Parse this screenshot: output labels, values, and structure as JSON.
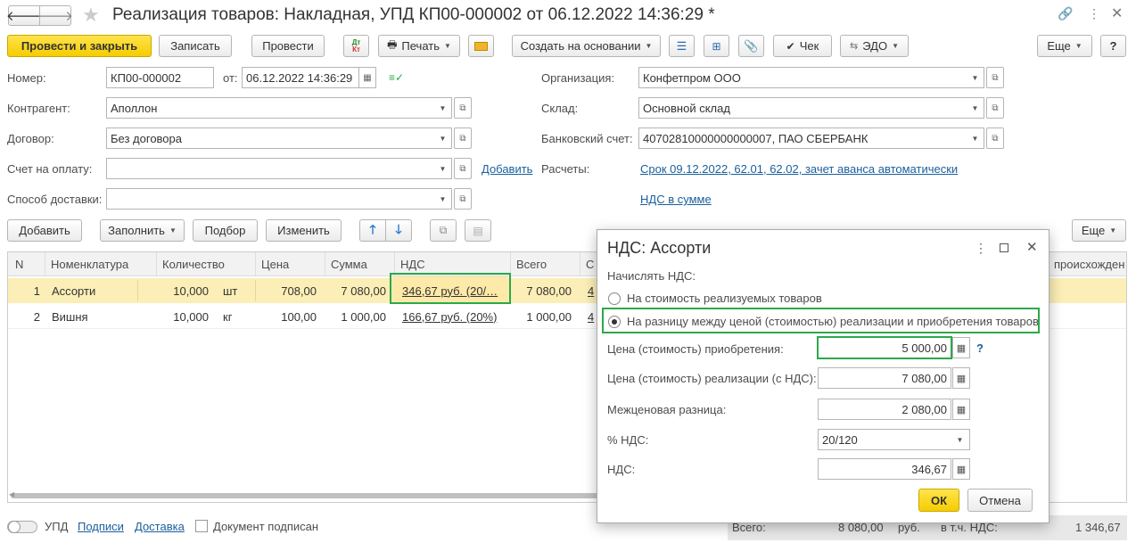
{
  "window": {
    "title": "Реализация товаров: Накладная, УПД КП00-000002 от 06.12.2022 14:36:29 *"
  },
  "toolbar": {
    "post_close": "Провести и закрыть",
    "save": "Записать",
    "post": "Провести",
    "print": "Печать",
    "create_based": "Создать на основании",
    "receipt": "Чек",
    "edo": "ЭДО",
    "more": "Еще",
    "help": "?",
    "dtkt_top": "Дт",
    "dtkt_bottom": "Кт"
  },
  "form": {
    "number_label": "Номер:",
    "number_value": "КП00-000002",
    "date_label": "от:",
    "date_value": "06.12.2022 14:36:29",
    "contractor_label": "Контрагент:",
    "contractor_value": "Аполлон",
    "contract_label": "Договор:",
    "contract_value": "Без договора",
    "invoice_label": "Счет на оплату:",
    "invoice_value": "",
    "invoice_add": "Добавить",
    "delivery_label": "Способ доставки:",
    "delivery_value": "",
    "org_label": "Организация:",
    "org_value": "Конфетпром ООО",
    "warehouse_label": "Склад:",
    "warehouse_value": "Основной склад",
    "bank_label": "Банковский счет:",
    "bank_value": "40702810000000000007, ПАО СБЕРБАНК",
    "settlements_label": "Расчеты:",
    "settlements_link": "Срок 09.12.2022, 62.01, 62.02, зачет аванса автоматически",
    "vat_link": "НДС в сумме"
  },
  "table_toolbar": {
    "add": "Добавить",
    "fill": "Заполнить",
    "pick": "Подбор",
    "change": "Изменить",
    "more": "Еще"
  },
  "table": {
    "headers": [
      "N",
      "Номенклатура",
      "Количество",
      "Цена",
      "Сумма",
      "НДС",
      "Всего",
      "С",
      "происхожден"
    ],
    "rows": [
      {
        "n": "1",
        "name": "Ассорти",
        "qty": "10,000",
        "unit": "шт",
        "price": "708,00",
        "sum": "7 080,00",
        "vat": "346,67 руб. (20/…",
        "total": "7 080,00",
        "extra": "4"
      },
      {
        "n": "2",
        "name": "Вишня",
        "qty": "10,000",
        "unit": "кг",
        "price": "100,00",
        "sum": "1 000,00",
        "vat": "166,67 руб. (20%)",
        "total": "1 000,00",
        "extra": "4"
      }
    ]
  },
  "footer": {
    "upd": "УПД",
    "signatures": "Подписи",
    "delivery": "Доставка",
    "signed": "Документ подписан",
    "total_label": "Всего:",
    "total_value": "8 080,00",
    "currency": "руб.",
    "vat_label": "в т.ч. НДС:",
    "vat_value": "1 346,67"
  },
  "dialog": {
    "title": "НДС: Ассорти",
    "charge_label": "Начислять НДС:",
    "option1": "На стоимость реализуемых товаров",
    "option2": "На разницу между ценой (стоимостью) реализации и приобретения товаров",
    "selected_option": 2,
    "purchase_label": "Цена (стоимость) приобретения:",
    "purchase_value": "5 000,00",
    "help": "?",
    "sale_label": "Цена (стоимость) реализации (с НДС):",
    "sale_value": "7 080,00",
    "diff_label": "Межценовая разница:",
    "diff_value": "2 080,00",
    "rate_label": "% НДС:",
    "rate_value": "20/120",
    "vat_label": "НДС:",
    "vat_value": "346,67",
    "ok": "ОК",
    "cancel": "Отмена"
  },
  "colors": {
    "primary_button": "#f5cd00",
    "link": "#1a5f9c",
    "highlight_green": "#2ba84a",
    "selected_row": "#fbeeb6"
  }
}
